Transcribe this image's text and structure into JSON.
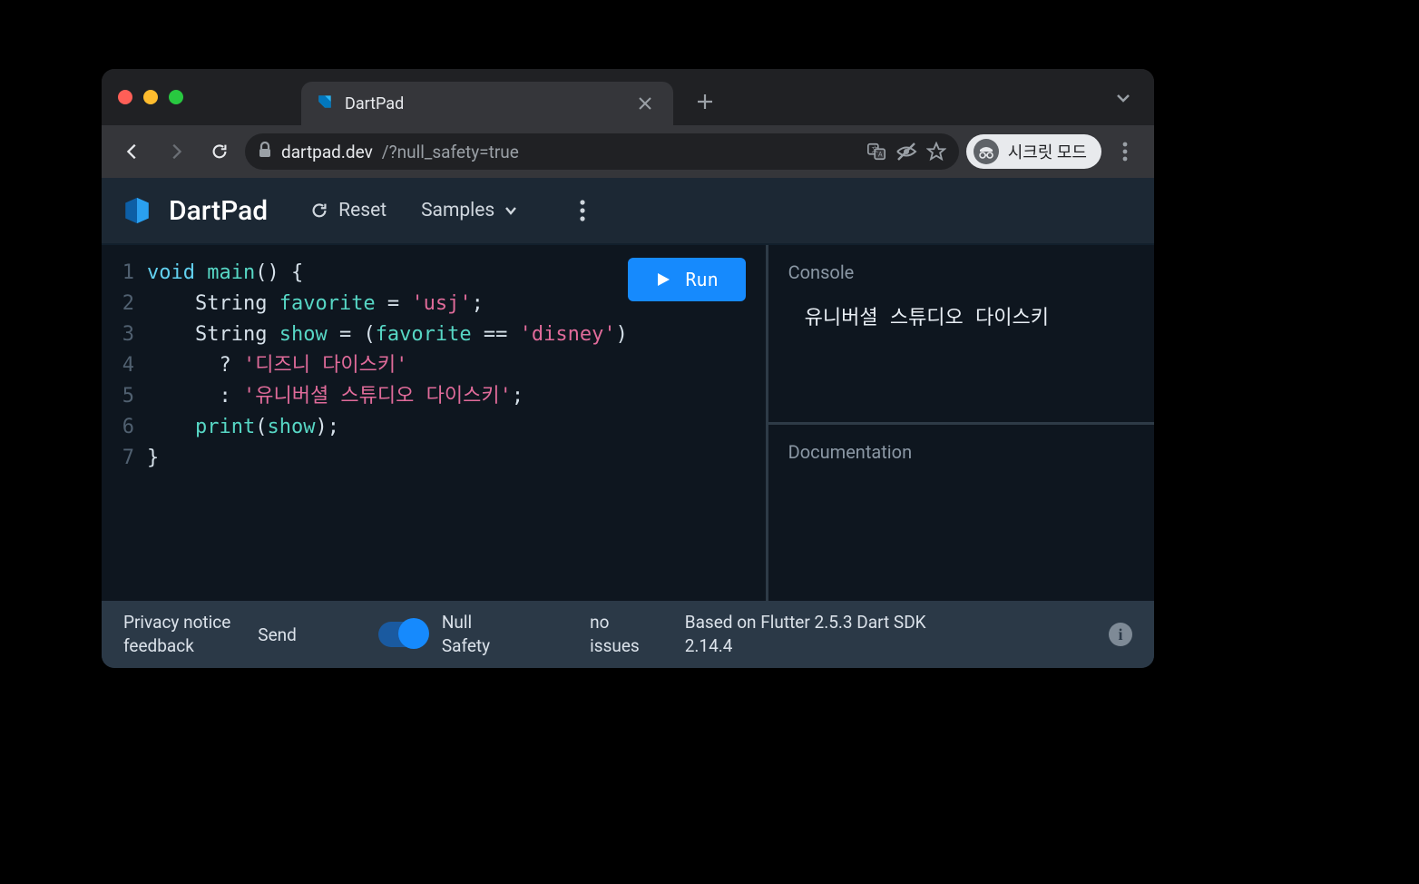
{
  "browser": {
    "tab_title": "DartPad",
    "url_host": "dartpad.dev",
    "url_path": "/?null_safety=true",
    "incognito_label": "시크릿 모드"
  },
  "header": {
    "brand": "DartPad",
    "reset_label": "Reset",
    "samples_label": "Samples"
  },
  "run_button": "Run",
  "code": {
    "lines": [
      {
        "n": "1"
      },
      {
        "n": "2"
      },
      {
        "n": "3"
      },
      {
        "n": "4"
      },
      {
        "n": "5"
      },
      {
        "n": "6"
      },
      {
        "n": "7"
      }
    ],
    "l1_kw": "void",
    "l1_fn": "main",
    "l1_rest": "() {",
    "l2_type": "String",
    "l2_name": "favorite",
    "l2_eq": " = ",
    "l2_str": "'usj'",
    "l2_semi": ";",
    "l3_type": "String",
    "l3_name": "show",
    "l3_mid_a": " = (",
    "l3_var": "favorite",
    "l3_mid_b": " == ",
    "l3_str": "'disney'",
    "l3_end": ")",
    "l4_op": "? ",
    "l4_str": "'디즈니 다이스키'",
    "l5_op": ": ",
    "l5_str": "'유니버셜 스튜디오 다이스키'",
    "l5_semi": ";",
    "l6_fn": "print",
    "l6_open": "(",
    "l6_arg": "show",
    "l6_close": ");",
    "l7": "}"
  },
  "console": {
    "title": "Console",
    "output": "유니버셜 스튜디오 다이스키"
  },
  "docs": {
    "title": "Documentation"
  },
  "footer": {
    "privacy_l1": "Privacy notice",
    "privacy_l2": "feedback",
    "send": "Send",
    "null_l1": "Null",
    "null_l2": "Safety",
    "issues_l1": "no",
    "issues_l2": "issues",
    "version_l1": "Based on Flutter 2.5.3 Dart SDK",
    "version_l2": "2.14.4"
  }
}
